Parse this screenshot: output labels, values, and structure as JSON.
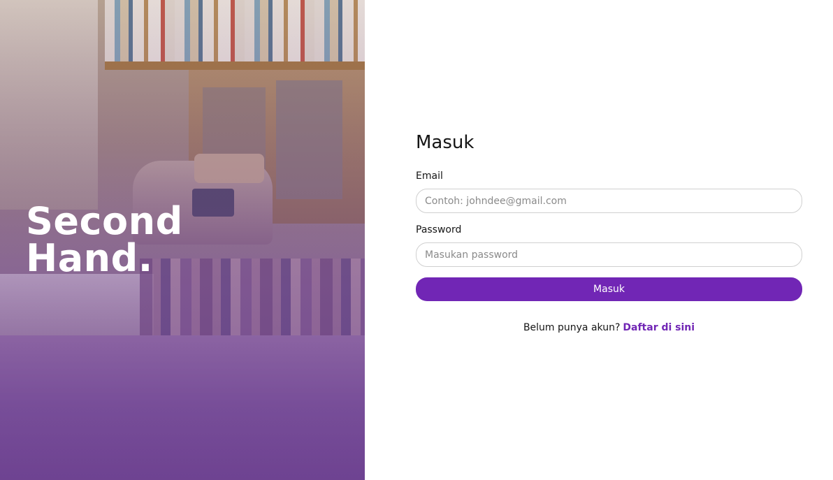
{
  "brand": {
    "line1": "Second",
    "line2": "Hand."
  },
  "login": {
    "title": "Masuk",
    "email_label": "Email",
    "email_placeholder": "Contoh: johndee@gmail.com",
    "email_value": "",
    "password_label": "Password",
    "password_placeholder": "Masukan password",
    "password_value": "",
    "submit_label": "Masuk",
    "no_account_text": "Belum punya akun?",
    "register_link": "Daftar di sini"
  },
  "colors": {
    "accent": "#7126b5",
    "text": "#151515",
    "input_border": "#d0d0d0",
    "placeholder": "#8a8a8a"
  },
  "hero": {
    "image": "bookstore-cash-register-photo"
  }
}
